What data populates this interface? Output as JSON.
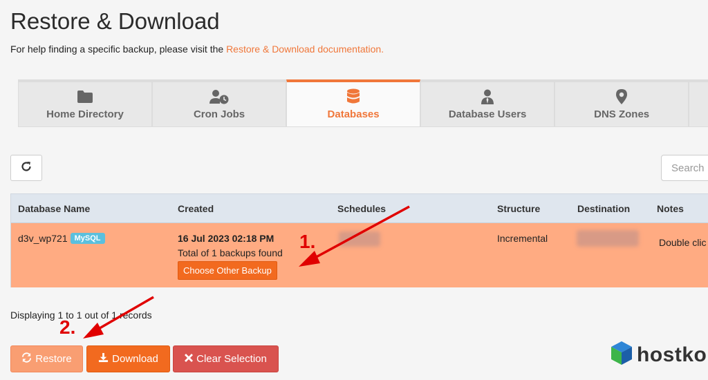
{
  "header": {
    "title": "Restore & Download",
    "help_prefix": "For help finding a specific backup, please visit the ",
    "help_link": "Restore & Download documentation."
  },
  "tabs": [
    {
      "label": "Home Directory",
      "icon": "folder-icon",
      "active": false
    },
    {
      "label": "Cron Jobs",
      "icon": "user-clock-icon",
      "active": false
    },
    {
      "label": "Databases",
      "icon": "database-icon",
      "active": true
    },
    {
      "label": "Database Users",
      "icon": "user-tie-icon",
      "active": false
    },
    {
      "label": "DNS Zones",
      "icon": "map-marker-icon",
      "active": false
    }
  ],
  "toolbar": {
    "search_placeholder": "Search"
  },
  "table": {
    "headers": [
      "Database Name",
      "Created",
      "Schedules",
      "Structure",
      "Destination",
      "Notes"
    ],
    "rows": [
      {
        "name": "d3v_wp721",
        "badge": "MySQL",
        "created": "16 Jul 2023 02:18 PM",
        "backups_found": "Total of 1 backups found",
        "choose_label": "Choose Other Backup",
        "structure": "Incremental",
        "notes": "Double clic"
      }
    ]
  },
  "records_text": "Displaying 1 to 1 out of 1 records",
  "actions": {
    "restore": "Restore",
    "download": "Download",
    "clear": "Clear Selection"
  },
  "annotations": {
    "step1": "1.",
    "step2": "2."
  },
  "brand": {
    "name": "hostko"
  },
  "colors": {
    "accent": "#f0773a",
    "selected_row": "#ffab82",
    "danger": "#d9534f",
    "badge": "#5bc0de",
    "annotation": "#e00000"
  }
}
